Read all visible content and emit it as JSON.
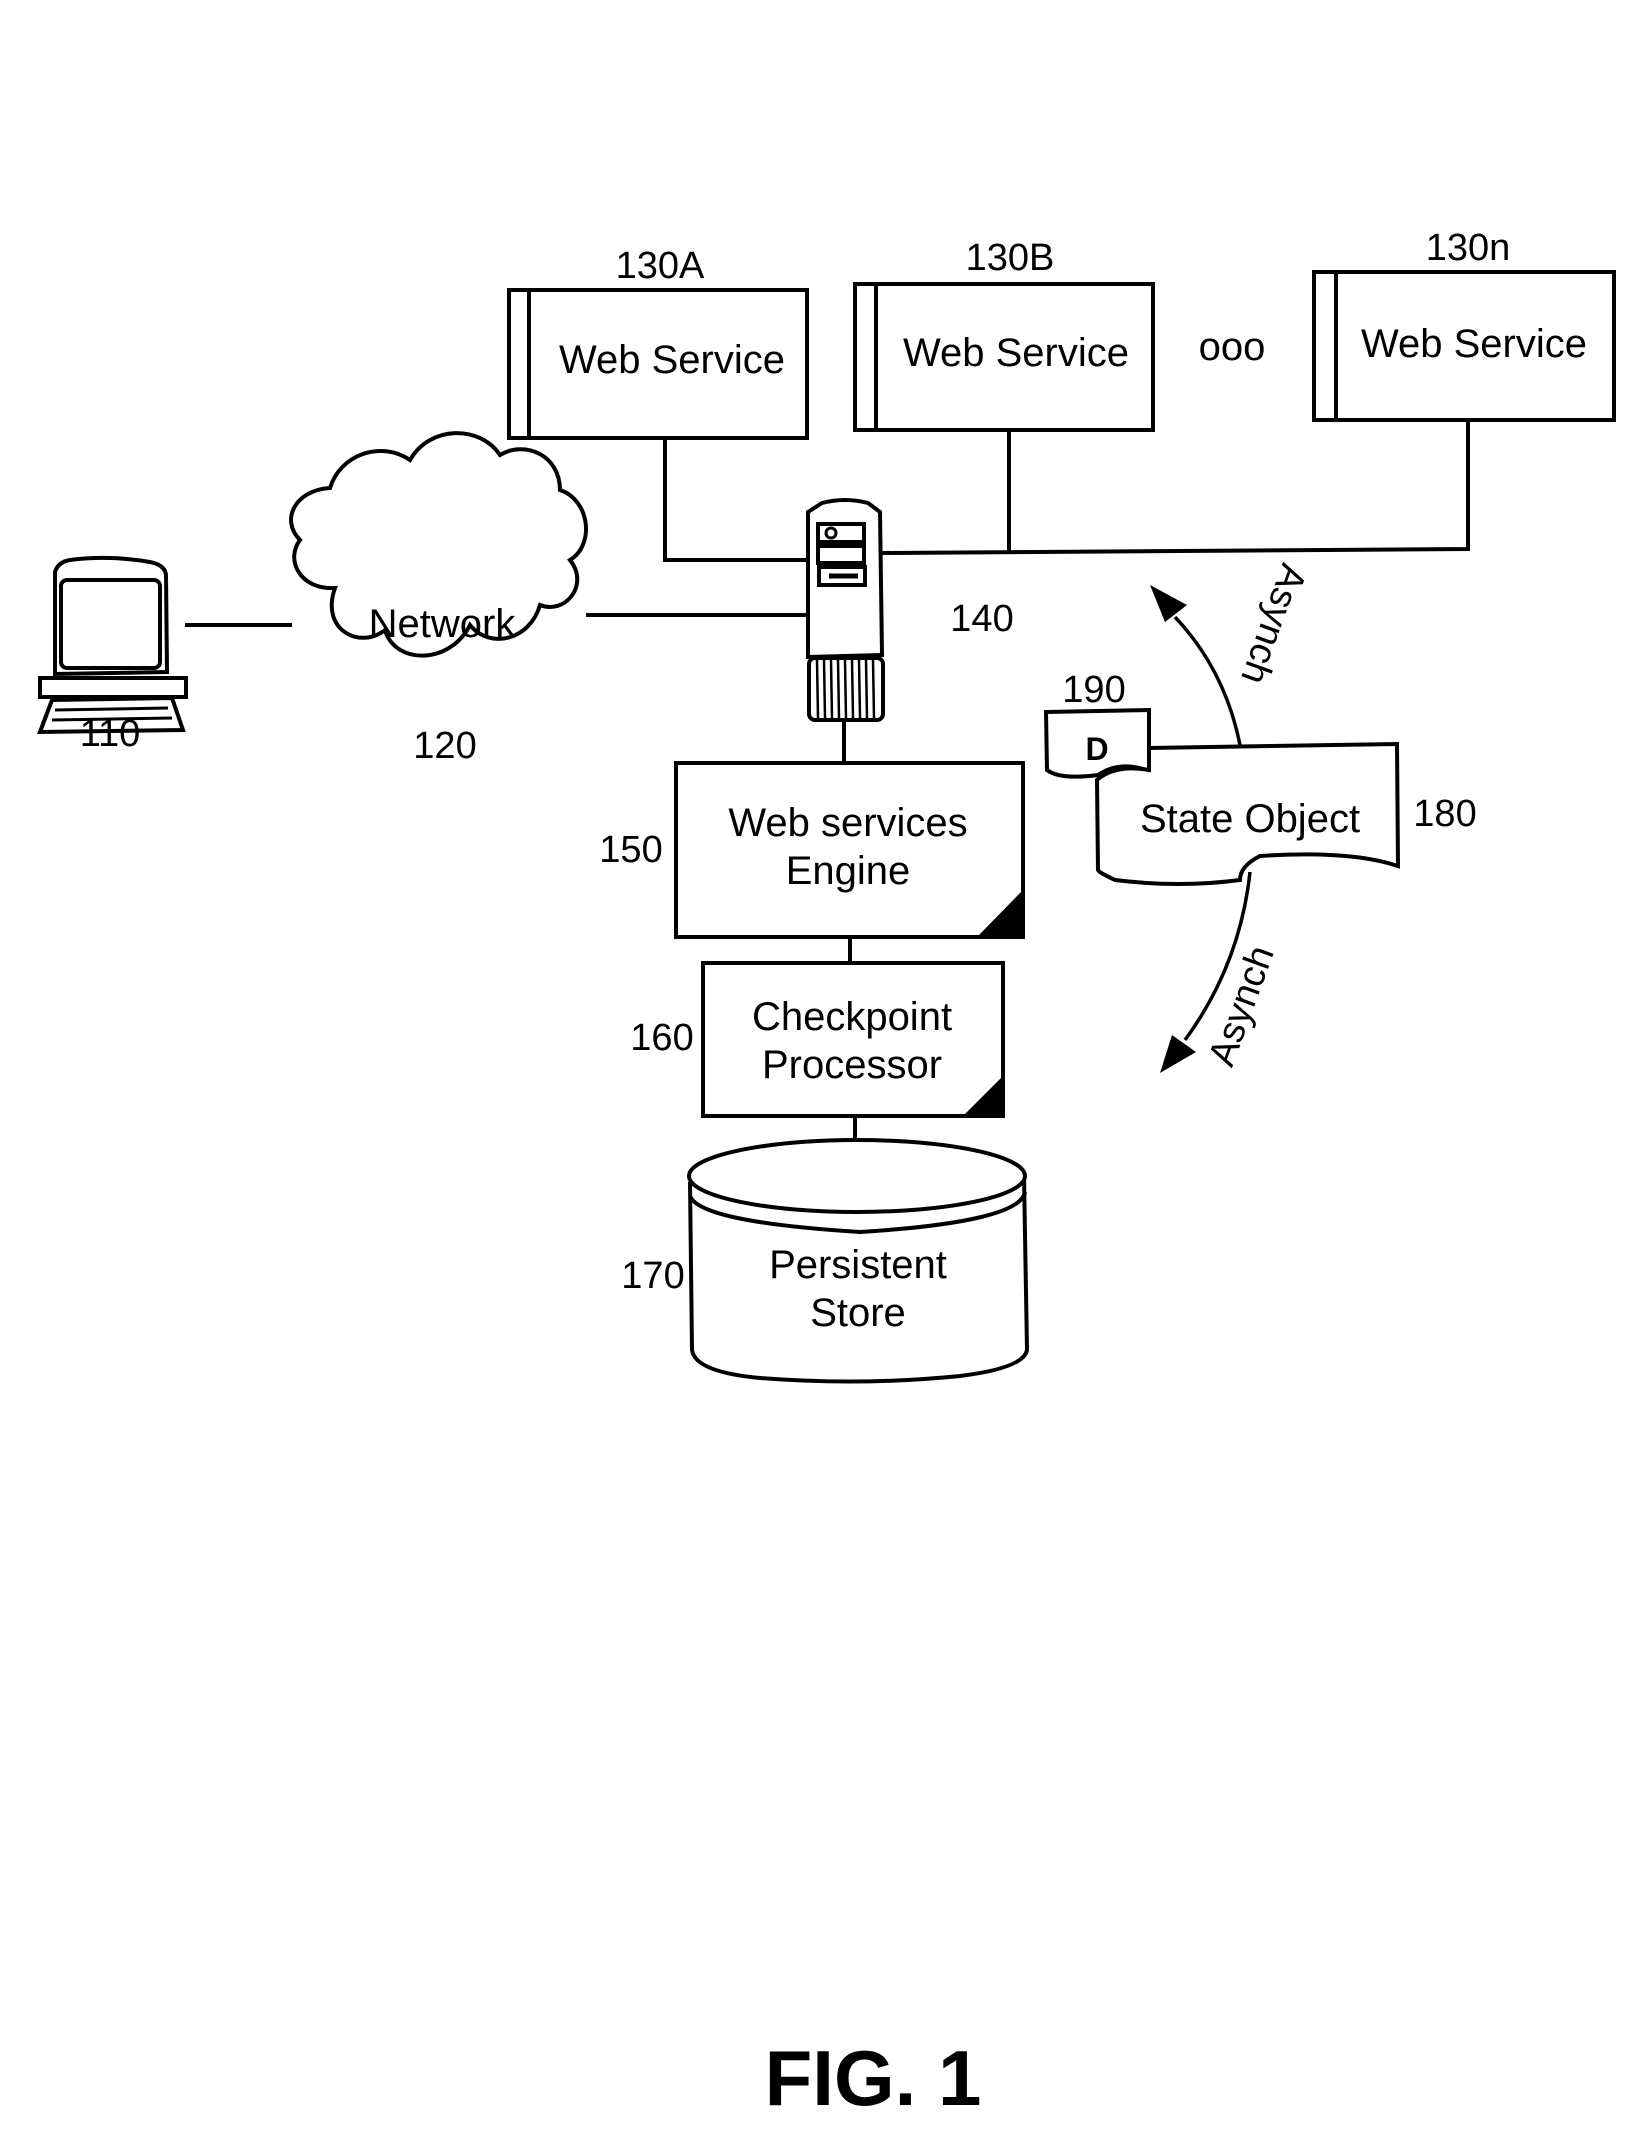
{
  "figure": {
    "caption": "FIG. 1",
    "nodes": {
      "client": {
        "ref": "110",
        "icon": "computer-icon"
      },
      "network": {
        "ref": "120",
        "label": "Network",
        "icon": "cloud-icon"
      },
      "web_services": [
        {
          "ref": "130A",
          "label": "Web Service"
        },
        {
          "ref": "130B",
          "label": "Web Service"
        },
        {
          "ref": "130n",
          "label": "Web Service"
        }
      ],
      "ellipsis": "ooo",
      "server": {
        "ref": "140",
        "icon": "server-tower-icon"
      },
      "engine": {
        "ref": "150",
        "label_line1": "Web services",
        "label_line2": "Engine"
      },
      "checkpoint": {
        "ref": "160",
        "label_line1": "Checkpoint",
        "label_line2": "Processor"
      },
      "store": {
        "ref": "170",
        "label_line1": "Persistent",
        "label_line2": "Store",
        "icon": "database-cylinder-icon"
      },
      "state_object": {
        "ref": "180",
        "label": "State Object"
      },
      "data_tab": {
        "ref": "190",
        "label": "D"
      }
    },
    "arrows": {
      "upper": "Asynch",
      "lower": "Asynch"
    }
  }
}
